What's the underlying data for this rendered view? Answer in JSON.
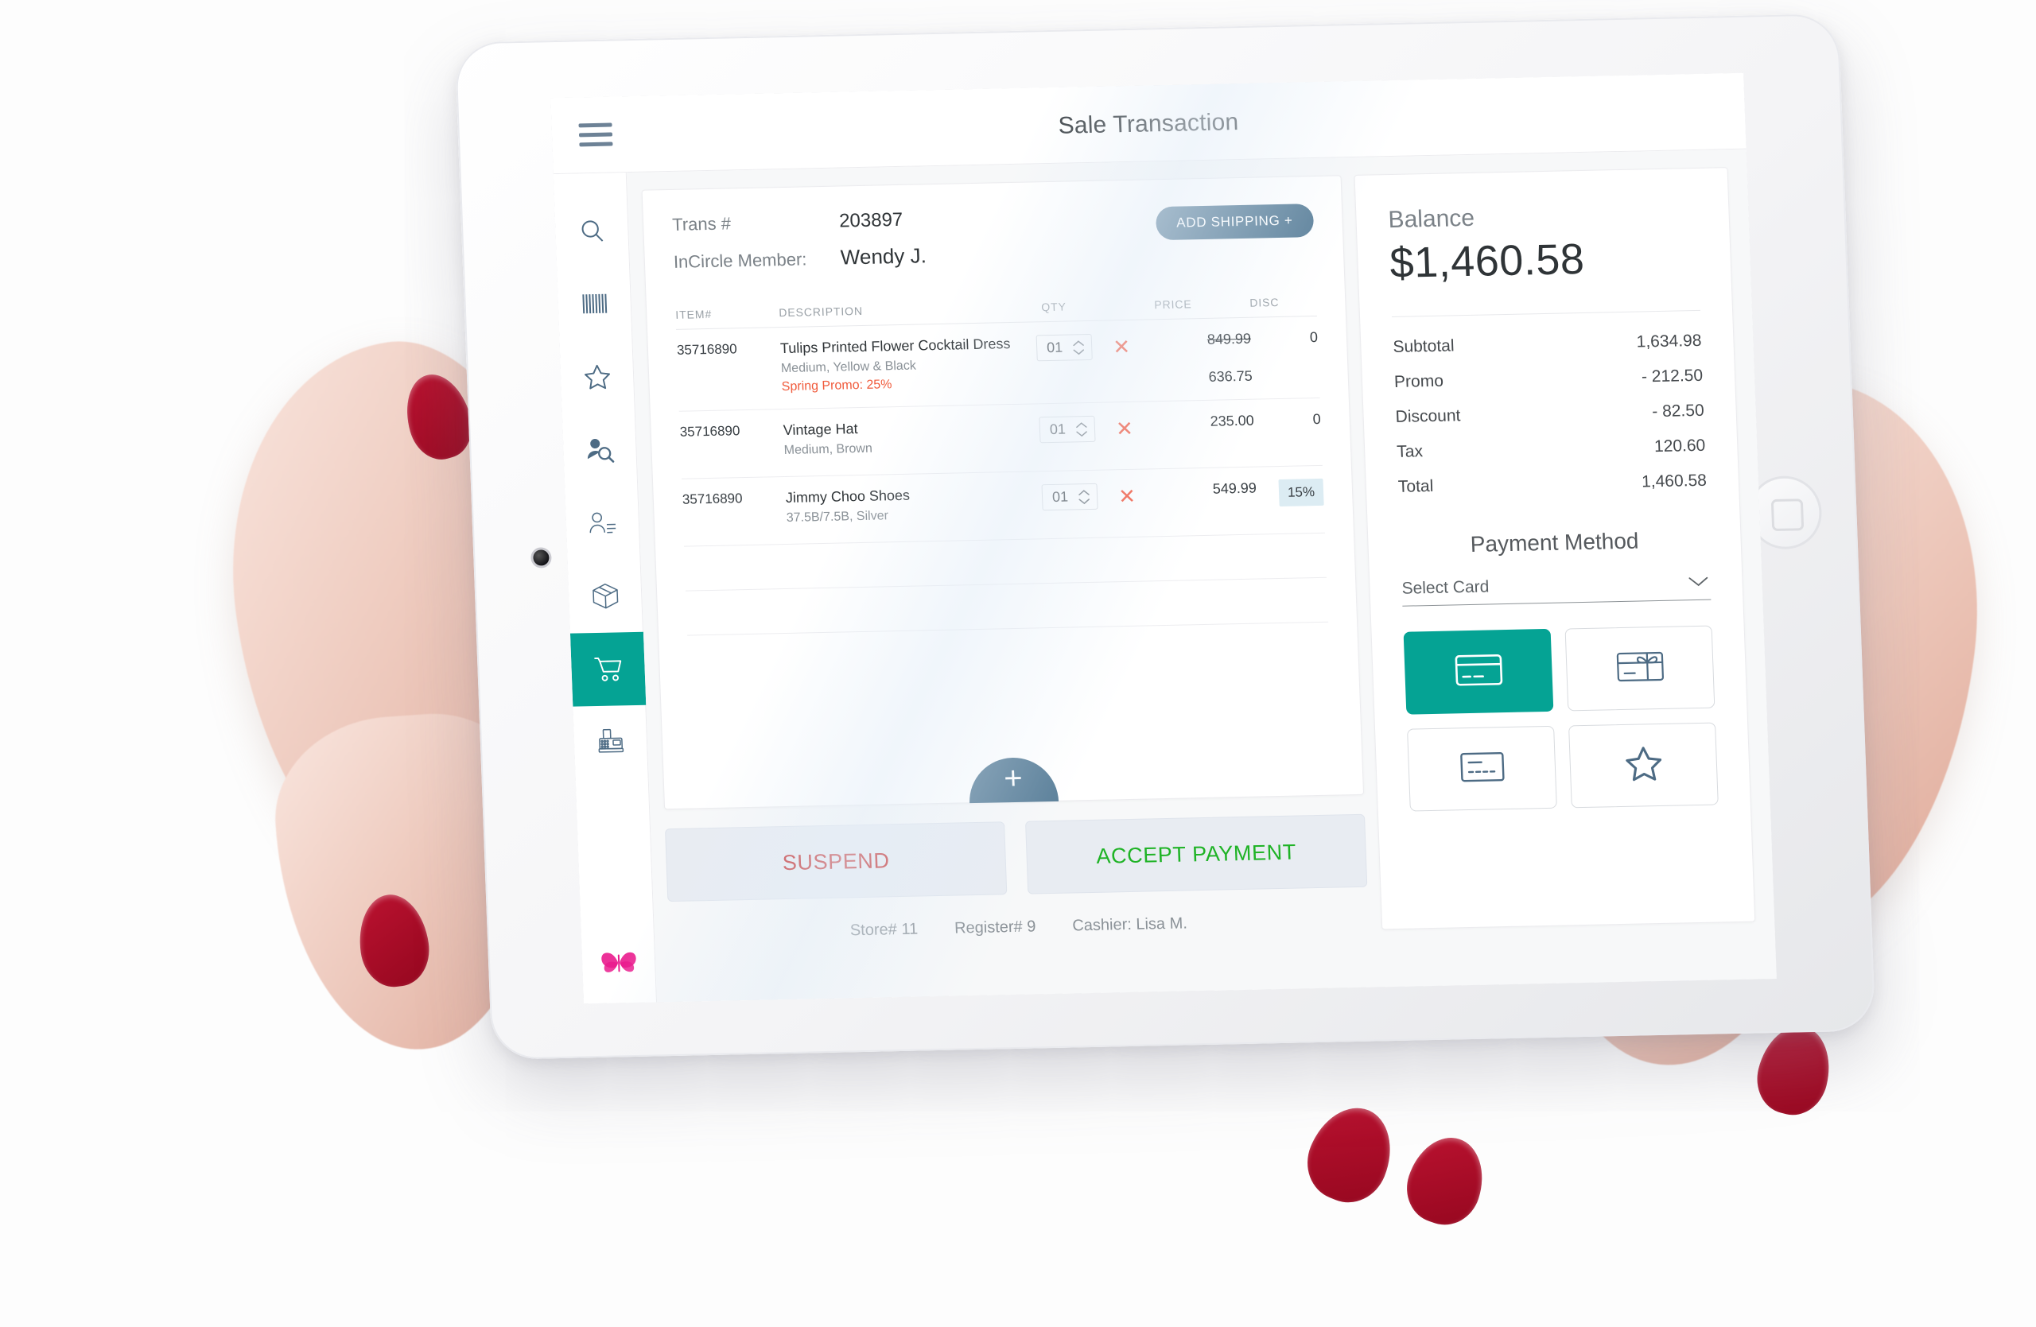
{
  "app": {
    "title": "Sale Transaction",
    "menu_icon": "hamburger-menu-icon",
    "accent_color": "#05a394",
    "secondary_color": "#5a7f99"
  },
  "sidebar": {
    "items": [
      {
        "icon": "search-icon",
        "name": "search",
        "active": false
      },
      {
        "icon": "barcode-icon",
        "name": "barcode-scan",
        "active": false
      },
      {
        "icon": "star-icon",
        "name": "favorites",
        "active": false
      },
      {
        "icon": "customer-search-icon",
        "name": "customer-lookup",
        "active": false
      },
      {
        "icon": "customer-profile-icon",
        "name": "customer-profile",
        "active": false
      },
      {
        "icon": "package-icon",
        "name": "inventory",
        "active": false
      },
      {
        "icon": "shopping-cart-icon",
        "name": "cart",
        "active": true
      },
      {
        "icon": "cash-register-icon",
        "name": "register",
        "active": false
      }
    ],
    "logo": "butterfly-logo"
  },
  "transaction": {
    "trans_number_label": "Trans #",
    "trans_number": "203897",
    "member_label": "InCircle Member:",
    "member_name": "Wendy J.",
    "add_shipping_label": "ADD SHIPPING  +",
    "columns": {
      "item": "ITEM#",
      "description": "DESCRIPTION",
      "qty": "QTY",
      "price": "PRICE",
      "disc": "DISC"
    },
    "items": [
      {
        "item_number": "35716890",
        "description": "Tulips Printed Flower Cocktail Dress",
        "attributes": "Medium, Yellow & Black",
        "promo": "Spring Promo: 25%",
        "qty": "01",
        "price_original": "849.99",
        "price_after": "636.75",
        "disc": "0",
        "disc_highlighted": false
      },
      {
        "item_number": "35716890",
        "description": "Vintage Hat",
        "attributes": "Medium, Brown",
        "promo": "",
        "qty": "01",
        "price_original": "",
        "price_after": "235.00",
        "disc": "0",
        "disc_highlighted": false
      },
      {
        "item_number": "35716890",
        "description": "Jimmy Choo Shoes",
        "attributes": "37.5B/7.5B, Silver",
        "promo": "",
        "qty": "01",
        "price_original": "",
        "price_after": "549.99",
        "disc": "15%",
        "disc_highlighted": true
      }
    ],
    "add_item_label": "+"
  },
  "actions": {
    "suspend_label": "SUSPEND",
    "accept_label": "ACCEPT PAYMENT"
  },
  "footer": {
    "store": "Store# 11",
    "register": "Register# 9",
    "cashier": "Cashier: Lisa M."
  },
  "balance": {
    "label": "Balance",
    "amount": "$1,460.58",
    "rows": [
      {
        "label": "Subtotal",
        "value": "1,634.98"
      },
      {
        "label": "Promo",
        "value": "- 212.50"
      },
      {
        "label": "Discount",
        "value": "- 82.50"
      },
      {
        "label": "Tax",
        "value": "120.60"
      },
      {
        "label": "Total",
        "value": "1,460.58"
      }
    ]
  },
  "payment": {
    "title": "Payment Method",
    "select_card_value": "Select Card",
    "select_card_placeholder": "Select Card",
    "tiles": [
      {
        "icon": "credit-card-icon",
        "name": "credit-card",
        "selected": true
      },
      {
        "icon": "gift-card-icon",
        "name": "gift-card",
        "selected": false
      },
      {
        "icon": "debit-card-icon",
        "name": "check",
        "selected": false
      },
      {
        "icon": "star-icon",
        "name": "loyalty",
        "selected": false
      }
    ]
  }
}
